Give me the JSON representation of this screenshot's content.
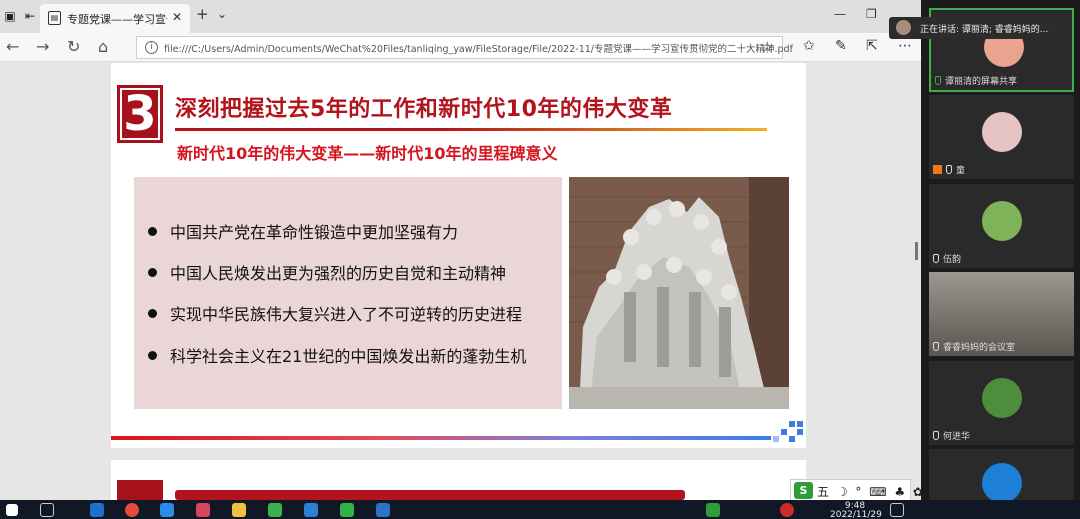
{
  "browser": {
    "tab_title": "专题党课——学习宣传贯彻",
    "url": "file:///C:/Users/Admin/Documents/WeChat%20Files/tanliqing_yaw/FileStorage/File/2022-11/专题党课——学习宣传贯彻党的二十大精神.pdf",
    "new_tab": "+",
    "tab_close": "✕"
  },
  "slide": {
    "number": "3",
    "title": "深刻把握过去5年的工作和新时代10年的伟大变革",
    "subtitle": "新时代10年的伟大变革——新时代10年的里程碑意义",
    "bullets": [
      "中国共产党在革命性锻造中更加坚强有力",
      "中国人民焕发出更为强烈的历史自觉和主动精神",
      "实现中华民族伟大复兴进入了不可逆转的历史进程",
      "科学社会主义在21世纪的中国焕发出新的蓬勃生机"
    ],
    "brand_colors": {
      "red": "#b3131c",
      "gold": "#f0b323",
      "blue": "#3b7ee3"
    }
  },
  "ime": {
    "logo": "S",
    "mode": "五 ☽ ° ⌨ ♣ ✿"
  },
  "meeting": {
    "speaking": "正在讲话: 谭丽清; 睿睿妈妈的...",
    "participants": [
      {
        "name": "谭丽清的屏幕共享",
        "active": true
      },
      {
        "name": "童"
      },
      {
        "name": "伍韵"
      },
      {
        "name": "睿睿妈妈的会议室"
      },
      {
        "name": "何进华"
      },
      {
        "name": ""
      }
    ]
  },
  "taskbar": {
    "time": "9:48",
    "date": "2022/11/29"
  }
}
